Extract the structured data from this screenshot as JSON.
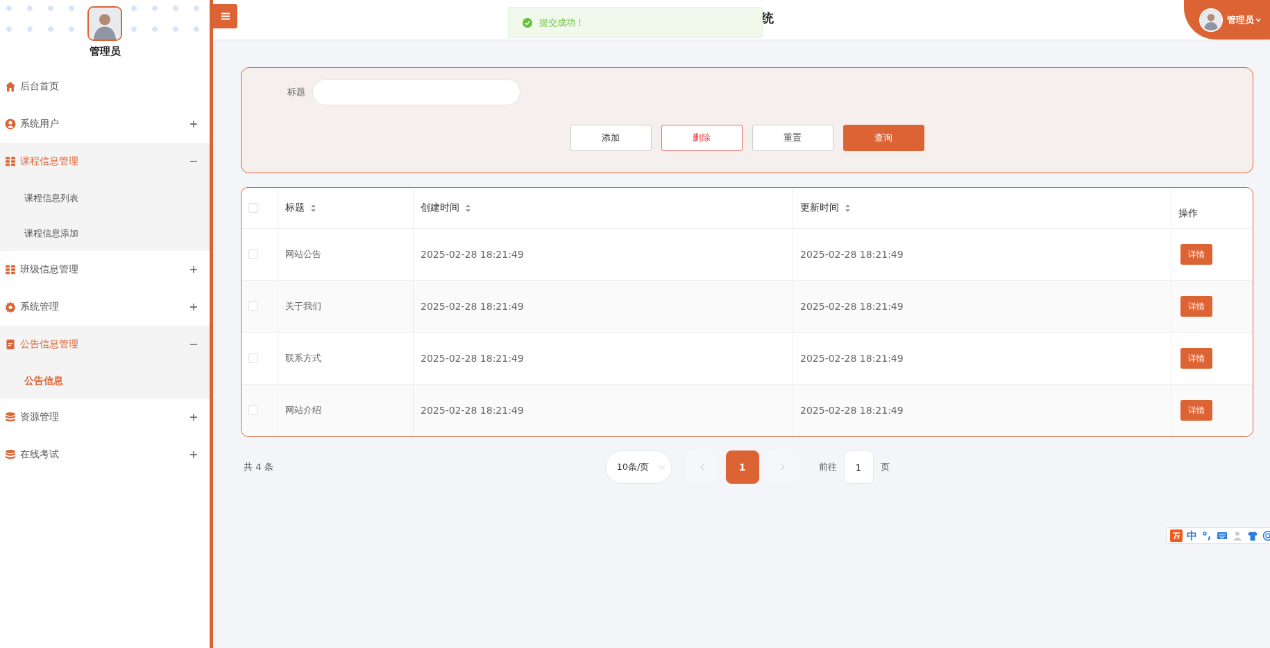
{
  "sidebar": {
    "user_name": "管理员",
    "menu": [
      {
        "kind": "home",
        "label": "后台首页"
      },
      {
        "kind": "user",
        "label": "系统用户",
        "expanded": false
      },
      {
        "kind": "grid",
        "label": "课程信息管理",
        "expanded": true,
        "children": [
          {
            "label": "课程信息列表",
            "selected": false
          },
          {
            "label": "课程信息添加",
            "selected": false
          }
        ]
      },
      {
        "kind": "grid",
        "label": "班级信息管理",
        "expanded": false
      },
      {
        "kind": "gear",
        "label": "系统管理",
        "expanded": false
      },
      {
        "kind": "doc",
        "label": "公告信息管理",
        "expanded": true,
        "children": [
          {
            "label": "公告信息",
            "selected": true
          }
        ]
      },
      {
        "kind": "database",
        "label": "资源管理",
        "expanded": false
      },
      {
        "kind": "database",
        "label": "在线考试",
        "expanded": false
      }
    ]
  },
  "header": {
    "title": "统",
    "user": "管理员",
    "toast": "提交成功！"
  },
  "search_form": {
    "label": "标题",
    "buttons": [
      {
        "label": "添加",
        "kind": "default"
      },
      {
        "label": "删除",
        "kind": "danger"
      },
      {
        "label": "重置",
        "kind": "default"
      },
      {
        "label": "查询",
        "kind": "primary"
      }
    ]
  },
  "table": {
    "all_checked": false,
    "columns": [
      {
        "label": "标题",
        "sortable": true
      },
      {
        "label": "创建时间",
        "sortable": true
      },
      {
        "label": "更新时间",
        "sortable": true
      },
      {
        "label": "操作",
        "sortable": false
      }
    ],
    "rows": [
      {
        "checked": false,
        "cells": [
          "网站公告",
          "2025-02-28 18:21:49",
          "2025-02-28 18:21:49"
        ],
        "action": "详情"
      },
      {
        "checked": false,
        "cells": [
          "关于我们",
          "2025-02-28 18:21:49",
          "2025-02-28 18:21:49"
        ],
        "action": "详情"
      },
      {
        "checked": false,
        "cells": [
          "联系方式",
          "2025-02-28 18:21:49",
          "2025-02-28 18:21:49"
        ],
        "action": "详情"
      },
      {
        "checked": false,
        "cells": [
          "网站介绍",
          "2025-02-28 18:21:49",
          "2025-02-28 18:21:49"
        ],
        "action": "详情"
      }
    ]
  },
  "pagination": {
    "total": "共 4 条",
    "page_size": "10条/页",
    "pages": [
      {
        "label": "1",
        "selected": true
      }
    ],
    "goto_label": "前往",
    "goto_value": "1",
    "goto_suffix": "页"
  },
  "ime_toolbar": {
    "mode": "中"
  }
}
